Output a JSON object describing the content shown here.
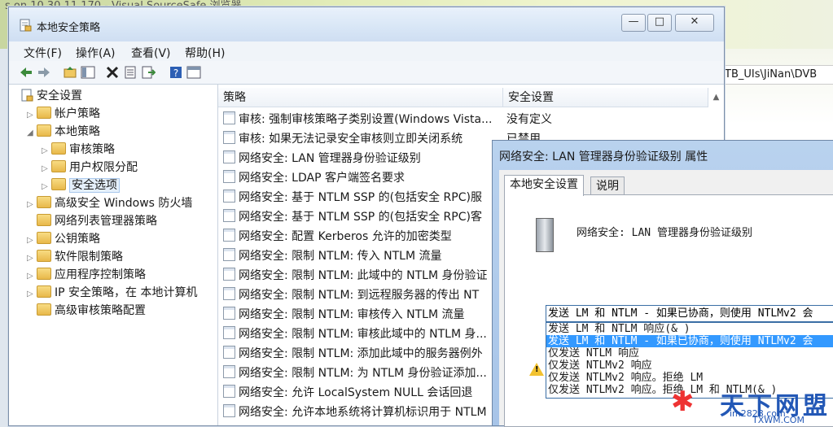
{
  "background": {
    "top_text": "s on 10.30.11.170 - Visual SourceSafe 浏览器",
    "path_text": "TB_UIs\\JiNan\\DVB"
  },
  "window": {
    "title": "本地安全策略",
    "min": "—",
    "max": "□",
    "close": "✕"
  },
  "menu": {
    "file": "文件(F)",
    "action": "操作(A)",
    "view": "查看(V)",
    "help": "帮助(H)"
  },
  "tree": {
    "root": "安全设置",
    "items": [
      {
        "label": "帐户策略",
        "level": 1
      },
      {
        "label": "本地策略",
        "level": 1
      },
      {
        "label": "审核策略",
        "level": 2
      },
      {
        "label": "用户权限分配",
        "level": 2
      },
      {
        "label": "安全选项",
        "level": 2
      },
      {
        "label": "高级安全 Windows 防火墙",
        "level": 1
      },
      {
        "label": "网络列表管理器策略",
        "level": 1
      },
      {
        "label": "公钥策略",
        "level": 1
      },
      {
        "label": "软件限制策略",
        "level": 1
      },
      {
        "label": "应用程序控制策略",
        "level": 1
      },
      {
        "label": "IP 安全策略，在 本地计算机",
        "level": 1
      },
      {
        "label": "高级审核策略配置",
        "level": 1
      }
    ]
  },
  "list": {
    "col_policy": "策略",
    "col_setting": "安全设置",
    "rows": [
      {
        "policy": "审核: 强制审核策略子类别设置(Windows Vista...",
        "setting": "没有定义"
      },
      {
        "policy": "审核: 如果无法记录安全审核则立即关闭系统",
        "setting": "已禁用"
      },
      {
        "policy": "网络安全: LAN 管理器身份验证级别",
        "setting": ""
      },
      {
        "policy": "网络安全: LDAP 客户端签名要求",
        "setting": ""
      },
      {
        "policy": "网络安全: 基于 NTLM SSP 的(包括安全 RPC)服",
        "setting": ""
      },
      {
        "policy": "网络安全: 基于 NTLM SSP 的(包括安全 RPC)客",
        "setting": ""
      },
      {
        "policy": "网络安全: 配置 Kerberos 允许的加密类型",
        "setting": ""
      },
      {
        "policy": "网络安全: 限制 NTLM: 传入 NTLM 流量",
        "setting": ""
      },
      {
        "policy": "网络安全: 限制 NTLM: 此域中的 NTLM 身份验证",
        "setting": ""
      },
      {
        "policy": "网络安全: 限制 NTLM: 到远程服务器的传出 NT",
        "setting": ""
      },
      {
        "policy": "网络安全: 限制 NTLM: 审核传入 NTLM 流量",
        "setting": ""
      },
      {
        "policy": "网络安全: 限制 NTLM: 审核此域中的 NTLM 身...",
        "setting": ""
      },
      {
        "policy": "网络安全: 限制 NTLM: 添加此域中的服务器例外",
        "setting": ""
      },
      {
        "policy": "网络安全: 限制 NTLM: 为 NTLM 身份验证添加...",
        "setting": ""
      },
      {
        "policy": "网络安全: 允许 LocalSystem NULL 会话回退",
        "setting": ""
      },
      {
        "policy": "网络安全: 允许本地系统将计算机标识用于 NTLM",
        "setting": ""
      }
    ]
  },
  "dialog": {
    "title": "网络安全: LAN 管理器身份验证级别 属性",
    "tab_local": "本地安全设置",
    "tab_explain": "说明",
    "policy_name": "网络安全: LAN 管理器身份验证级别",
    "selected_value": "发送 LM 和 NTLM - 如果已协商，则使用 NTLMv2 会",
    "options": [
      "发送 LM 和 NTLM 响应(& )",
      "发送 LM 和 NTLM - 如果已协商，则使用 NTLMv2 会",
      "仅发送 NTLM 响应",
      "仅发送 NTLMv2 响应",
      "仅发送 NTLMv2 响应。拒绝 LM",
      "仅发送 NTLMv2 响应。拒绝 LM 和 NTLM(& )"
    ],
    "highlighted_index": 1
  },
  "watermark": {
    "big": "天下网盟",
    "small": "im2828.com",
    "small2": "TXWM.COM"
  }
}
